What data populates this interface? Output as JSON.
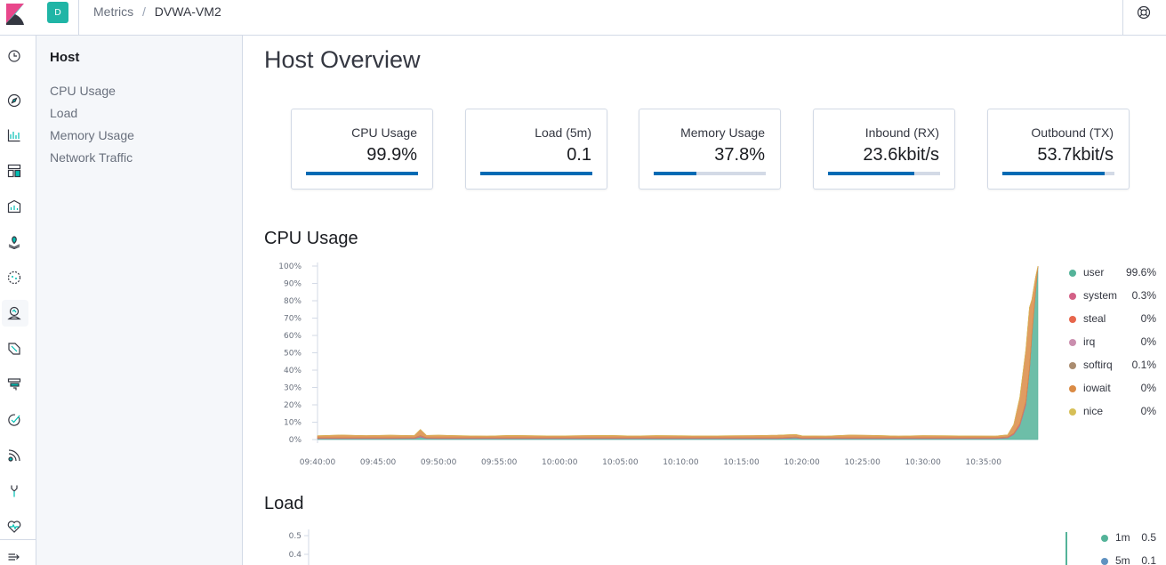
{
  "header": {
    "space_initial": "D",
    "breadcrumbs": {
      "app": "Metrics",
      "separator": "/",
      "host": "DVWA-VM2"
    },
    "help_icon": "help-lifebuoy-icon"
  },
  "nav_rail": {
    "icons": [
      "recently-viewed-clock-icon",
      "discover-compass-icon",
      "visualize-icon",
      "dashboard-icon",
      "canvas-icon",
      "maps-icon",
      "ml-icon",
      "metrics-icon",
      "logs-icon",
      "apm-icon",
      "uptime-icon",
      "siem-icon",
      "dev-tools-icon",
      "monitoring-icon",
      "collapse-icon"
    ],
    "active": "metrics-icon"
  },
  "sidenav": {
    "title": "Host",
    "items": [
      "CPU Usage",
      "Load",
      "Memory Usage",
      "Network Traffic"
    ]
  },
  "page_title": "Host Overview",
  "kpis": [
    {
      "label": "CPU Usage",
      "value": "99.9%",
      "fill_fraction": 1.0
    },
    {
      "label": "Load (5m)",
      "value": "0.1",
      "fill_fraction": 1.0
    },
    {
      "label": "Memory Usage",
      "value": "37.8%",
      "fill_fraction": 0.378
    },
    {
      "label": "Inbound (RX)",
      "value": "23.6kbit/s",
      "fill_fraction": 0.77
    },
    {
      "label": "Outbound (TX)",
      "value": "53.7kbit/s",
      "fill_fraction": 0.91
    }
  ],
  "colors": {
    "accent": "#006bb4",
    "user": "#54b399",
    "system": "#d36086",
    "steal": "#e7664c",
    "irq": "#ca8eae",
    "softirq": "#aa8c6f",
    "iowait": "#da8b45",
    "nice": "#d6bf57",
    "load_1m": "#54b399",
    "load_5m": "#6092c0"
  },
  "sections": {
    "cpu": "CPU Usage",
    "load": "Load"
  },
  "cpu_legend": [
    {
      "name": "user",
      "value": "99.6%"
    },
    {
      "name": "system",
      "value": "0.3%"
    },
    {
      "name": "steal",
      "value": "0%"
    },
    {
      "name": "irq",
      "value": "0%"
    },
    {
      "name": "softirq",
      "value": "0.1%"
    },
    {
      "name": "iowait",
      "value": "0%"
    },
    {
      "name": "nice",
      "value": "0%"
    }
  ],
  "load_legend": [
    {
      "name": "1m",
      "value": "0.5"
    },
    {
      "name": "5m",
      "value": "0.1"
    }
  ],
  "chart_data": [
    {
      "type": "area",
      "title": "CPU Usage",
      "x_ticks": [
        "09:40:00",
        "09:45:00",
        "09:50:00",
        "09:55:00",
        "10:00:00",
        "10:05:00",
        "10:10:00",
        "10:15:00",
        "10:20:00",
        "10:25:00",
        "10:30:00",
        "10:35:00"
      ],
      "x_range_minutes": [
        0,
        59.5
      ],
      "y_ticks": [
        "0%",
        "10%",
        "20%",
        "30%",
        "40%",
        "50%",
        "60%",
        "70%",
        "80%",
        "90%",
        "100%"
      ],
      "ylim": [
        0,
        100
      ],
      "x_minutes": [
        0,
        2,
        4,
        6,
        8,
        8.5,
        9,
        10,
        12,
        14,
        16,
        18,
        20,
        22,
        24,
        26,
        28,
        30,
        32,
        34,
        36,
        38,
        39.5,
        40,
        42,
        44,
        46,
        47,
        48,
        50,
        52,
        54,
        56,
        57,
        57.5,
        58,
        58.5,
        58.8,
        59,
        59.3,
        59.5
      ],
      "series": [
        {
          "name": "user",
          "values": [
            0.5,
            0.5,
            0.5,
            0.5,
            0.6,
            1.5,
            0.6,
            0.5,
            0.5,
            0.5,
            0.5,
            0.5,
            0.5,
            0.5,
            0.5,
            0.5,
            0.5,
            0.5,
            0.5,
            0.5,
            0.5,
            0.5,
            1.0,
            0.5,
            0.5,
            0.5,
            0.5,
            0.5,
            0.5,
            0.5,
            0.5,
            0.5,
            0.5,
            1.0,
            3,
            8,
            20,
            40,
            60,
            85,
            99.6
          ]
        },
        {
          "name": "system",
          "values": [
            0.4,
            0.4,
            0.4,
            0.4,
            0.4,
            0.6,
            0.4,
            0.4,
            0.4,
            0.4,
            0.4,
            0.4,
            0.4,
            0.4,
            0.4,
            0.4,
            0.4,
            0.4,
            0.4,
            0.4,
            0.4,
            0.4,
            0.4,
            0.4,
            0.4,
            0.4,
            0.4,
            0.4,
            0.4,
            0.4,
            0.4,
            0.4,
            0.4,
            0.4,
            0.5,
            1.0,
            1.5,
            1.0,
            0.6,
            0.4,
            0.3
          ]
        },
        {
          "name": "steal",
          "values": [
            0,
            0,
            0,
            0,
            0,
            0,
            0,
            0,
            0,
            0,
            0,
            0,
            0,
            0,
            0,
            0,
            0,
            0,
            0,
            0,
            0,
            0,
            0,
            0,
            0,
            0,
            0,
            0,
            0,
            0,
            0,
            0,
            0,
            0,
            0,
            0,
            0,
            0,
            0,
            0,
            0
          ]
        },
        {
          "name": "irq",
          "values": [
            0,
            0,
            0,
            0,
            0,
            0,
            0,
            0,
            0,
            0,
            0,
            0,
            0,
            0,
            0,
            0,
            0,
            0,
            0,
            0,
            0,
            0,
            0,
            0,
            0,
            0,
            0,
            0,
            0,
            0,
            0,
            0,
            0,
            0,
            0,
            0,
            0,
            0,
            0,
            0,
            0
          ]
        },
        {
          "name": "softirq",
          "values": [
            0.1,
            0.1,
            0.1,
            0.1,
            0.1,
            0.2,
            0.1,
            0.1,
            0.1,
            0.1,
            0.1,
            0.1,
            0.1,
            0.1,
            0.1,
            0.1,
            0.1,
            0.1,
            0.1,
            0.1,
            0.1,
            0.1,
            0.1,
            0.1,
            0.1,
            0.1,
            0.1,
            0.1,
            0.1,
            0.1,
            0.1,
            0.1,
            0.1,
            0.1,
            0.1,
            0.2,
            0.3,
            0.2,
            0.1,
            0.1,
            0.1
          ]
        },
        {
          "name": "iowait",
          "values": [
            1.2,
            1.6,
            1.3,
            1.5,
            1.2,
            3.5,
            1.3,
            1.5,
            1.2,
            1.0,
            1.4,
            1.2,
            1.1,
            1.3,
            1.4,
            1.1,
            1.3,
            1.2,
            1.1,
            1.2,
            1.3,
            1.5,
            1.4,
            1.2,
            1.0,
            1.6,
            1.4,
            1.2,
            1.0,
            1.3,
            1.2,
            1.1,
            1.0,
            1.2,
            5,
            15,
            30,
            35,
            20,
            8,
            0
          ]
        },
        {
          "name": "nice",
          "values": [
            0,
            0,
            0,
            0,
            0,
            0,
            0,
            0,
            0,
            0,
            0,
            0,
            0,
            0,
            0,
            0,
            0,
            0,
            0,
            0,
            0,
            0,
            0,
            0,
            0,
            0,
            0,
            0,
            0,
            0,
            0,
            0,
            0,
            0,
            0,
            0,
            0,
            0,
            0,
            0,
            0
          ]
        }
      ]
    },
    {
      "type": "line",
      "title": "Load",
      "y_ticks": [
        "0.5",
        "0.4"
      ],
      "ylim": [
        0,
        0.5
      ],
      "series": [
        {
          "name": "1m",
          "values": [
            0.5
          ]
        },
        {
          "name": "5m",
          "values": [
            0.1
          ]
        }
      ]
    }
  ]
}
